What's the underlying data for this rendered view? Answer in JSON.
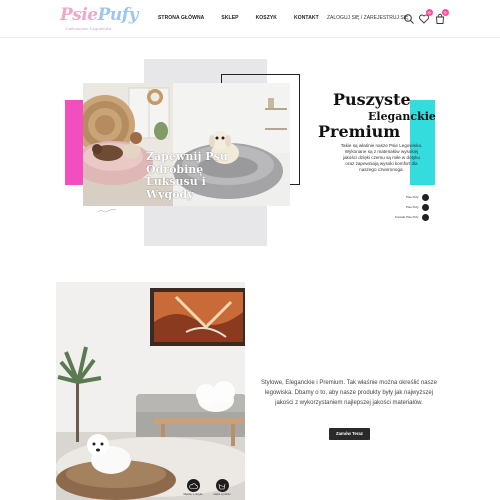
{
  "brand": {
    "logo_part1": "Psie",
    "logo_part2": "Pufy",
    "tagline": "Luksusowe Legowiska",
    "colors": {
      "pink": "#f2a6c9",
      "blue": "#9ec7f0"
    }
  },
  "nav": {
    "items": [
      {
        "label": "STRONA GŁÓWNA"
      },
      {
        "label": "SKLEP"
      },
      {
        "label": "KOSZYK"
      },
      {
        "label": "KONTAKT"
      }
    ]
  },
  "account": {
    "label": "ZALOGUJ SIĘ / ZAREJESTRUJ SIĘ"
  },
  "header_icons": {
    "search": "search-icon",
    "wishlist": "heart-icon",
    "wishlist_count": "0",
    "cart": "cart-icon",
    "cart_count": "0"
  },
  "hero": {
    "title_line1": "Puszyste",
    "title_line2": "Eleganckie",
    "title_line3": "Premium",
    "description": "Takie są właśnie nasze Psie Legowiska. Wykonane są z materiałów wysokiej jakości dzięki czemu są miłe w dotyku oraz zapewniają wysoki komfort dla naszego czworonoga.",
    "overlay_title": "Zapewnij Psu Odrobinę Luksusu i Wygody",
    "colors": {
      "pink_bar": "#f24ec0",
      "cyan_bar": "#35dcde",
      "gray_block": "#e7e7e9"
    },
    "social": [
      {
        "label": "Psie Pufy",
        "icon": "instagram-icon"
      },
      {
        "label": "Psie Pufy",
        "icon": "facebook-icon"
      },
      {
        "label": "Kontakt Psie Pufy",
        "icon": "email-icon"
      }
    ]
  },
  "section2": {
    "text": "Stylowe, Eleganckie i Premium. Tak właśnie można określić nasze legowiska. Dbamy o to, aby nasze produkty były jak najwyższej jakości z wykorzystaniem najlepszej jakości materiałów.",
    "cta_label": "Zamów Teraz",
    "features": [
      {
        "label": "Miękkie w dotyku",
        "icon": "cloud-icon"
      },
      {
        "label": "Łatwe w praniu",
        "icon": "wash-icon"
      }
    ]
  }
}
